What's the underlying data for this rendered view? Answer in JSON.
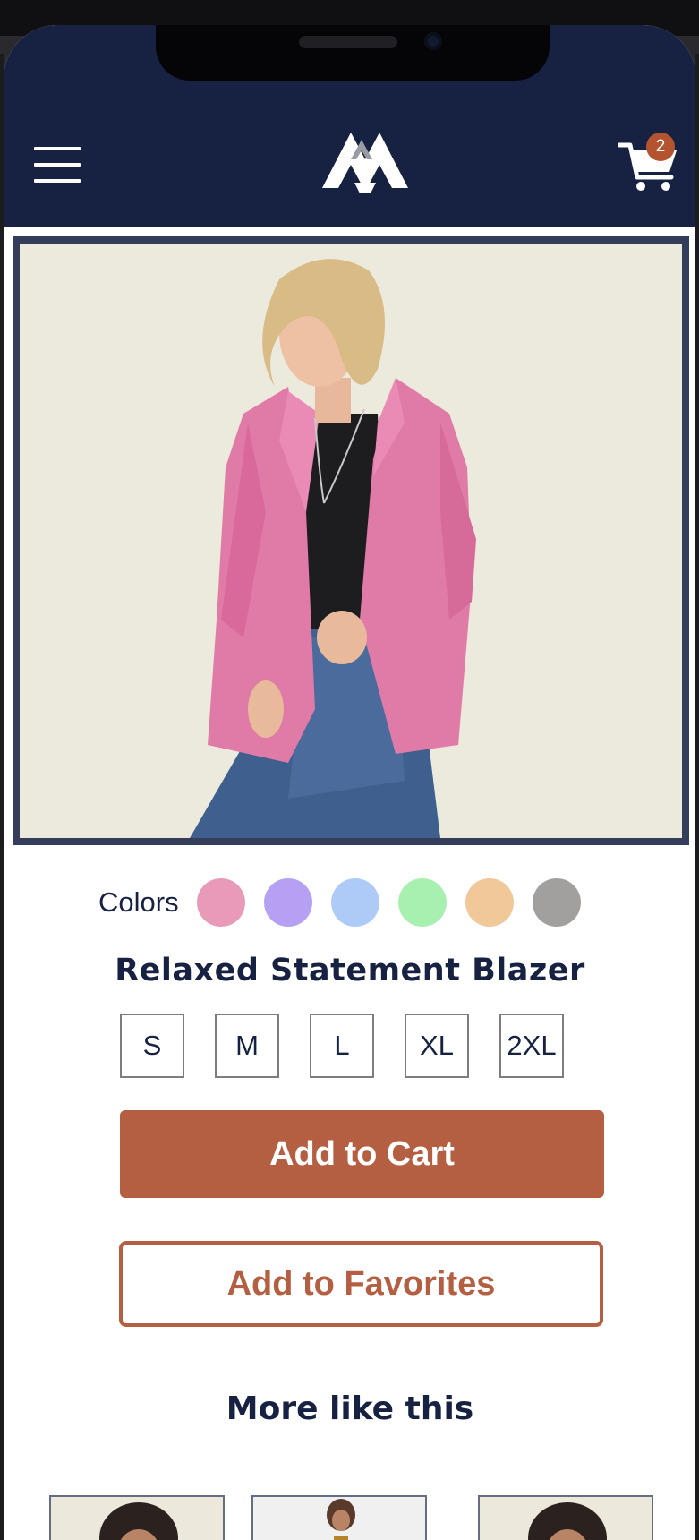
{
  "header": {
    "cart_count": "2",
    "logo_name": "mountain-logo",
    "brand_color": "#172243",
    "accent_color": "#b45f42"
  },
  "product": {
    "image_icon": "product-photo-pink-blazer",
    "colors_label": "Colors",
    "colors": [
      "#e89ab8",
      "#b6a0f4",
      "#aecbf8",
      "#a8f0b0",
      "#f1c89a",
      "#a29f9f"
    ],
    "name": "Relaxed Statement Blazer",
    "sizes": [
      "S",
      "M",
      "L",
      "XL",
      "2XL"
    ],
    "add_to_cart_label": "Add to Cart",
    "add_to_favorites_label": "Add to Favorites"
  },
  "more": {
    "title": "More like this",
    "items": [
      "thumb-woman-curly-hair",
      "thumb-woman-gray-blazer",
      "thumb-woman-curly-hair-2"
    ]
  }
}
